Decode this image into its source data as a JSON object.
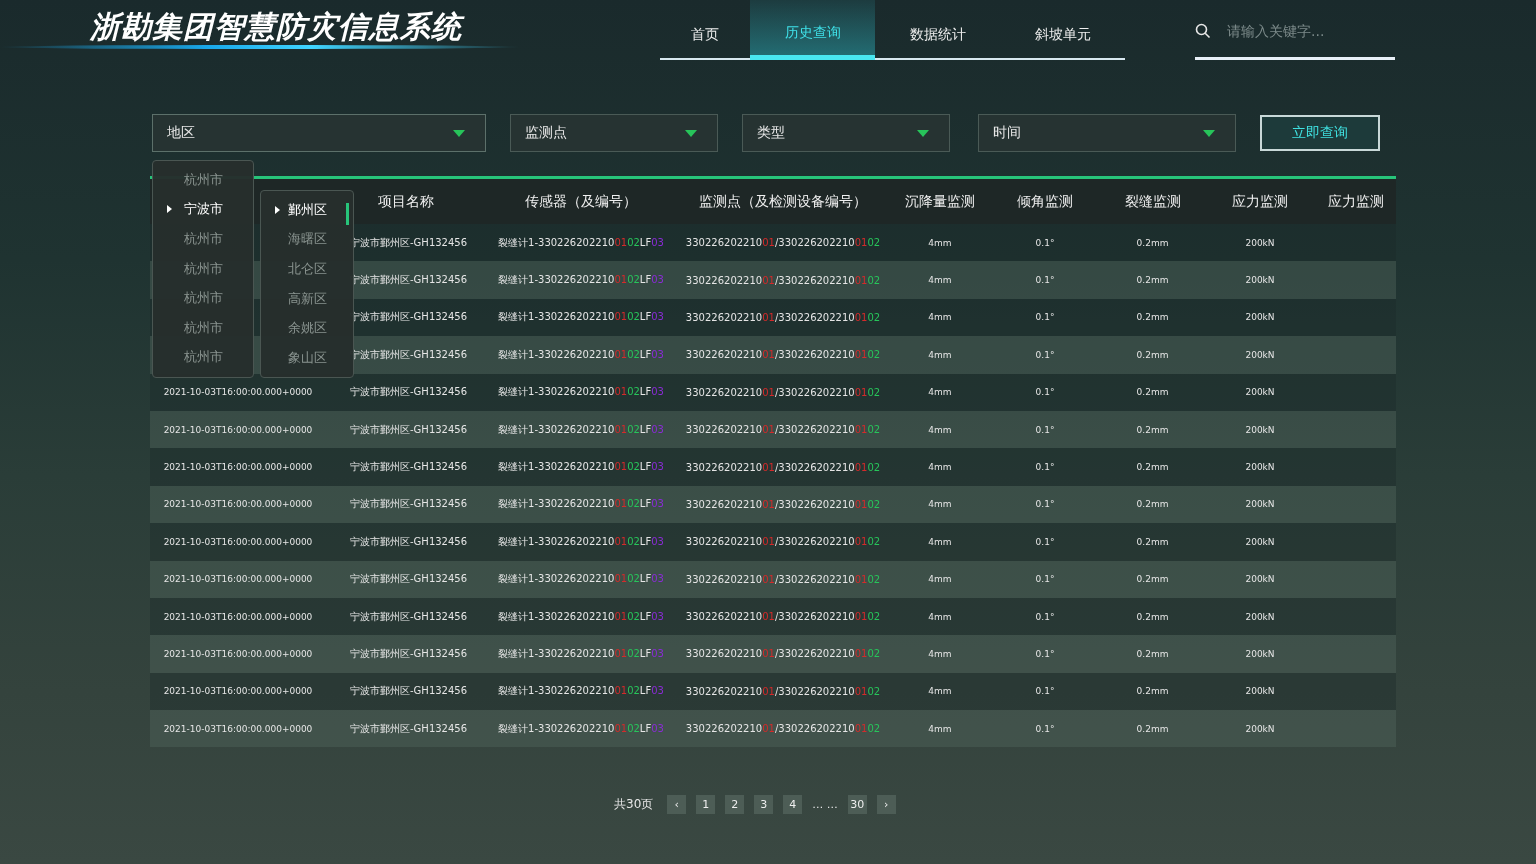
{
  "header": {
    "title": "浙勘集团智慧防灾信息系统",
    "tabs": [
      {
        "label": "首页",
        "selected": false
      },
      {
        "label": "历史查询",
        "selected": true
      },
      {
        "label": "数据统计",
        "selected": false
      },
      {
        "label": "斜坡单元",
        "selected": false
      }
    ],
    "search": {
      "placeholder": "请输入关键字..."
    }
  },
  "filters": [
    {
      "label": "地区",
      "open": true
    },
    {
      "label": "监测点",
      "open": false
    },
    {
      "label": "类型",
      "open": false
    },
    {
      "label": "时间",
      "open": false
    }
  ],
  "query_button": "立即查询",
  "cascader": [
    {
      "label": "杭州市",
      "selected": false
    },
    {
      "label": "宁波市",
      "selected": true,
      "children": [
        {
          "label": "鄞州区",
          "selected": true
        },
        {
          "label": "海曙区",
          "selected": false
        },
        {
          "label": "北仑区",
          "selected": false
        },
        {
          "label": "高新区",
          "selected": false
        },
        {
          "label": "余姚区",
          "selected": false
        },
        {
          "label": "象山区",
          "selected": false
        }
      ]
    },
    {
      "label": "杭州市",
      "selected": false
    },
    {
      "label": "杭州市",
      "selected": false
    },
    {
      "label": "杭州市",
      "selected": false
    },
    {
      "label": "杭州市",
      "selected": false
    },
    {
      "label": "杭州市",
      "selected": false
    }
  ],
  "table": {
    "columns": [
      "",
      "项目名称",
      "传感器（及编号）",
      "监测点（及检测设备编号）",
      "沉降量监测",
      "倾角监测",
      "裂缝监测",
      "应力监测",
      "应力监测"
    ],
    "rows": [
      {
        "time": "",
        "project": "宁波市鄞州区-GH132456",
        "sensor": [
          {
            "text": "裂缝计1-330226202210",
            "color": "#e6e6e6"
          },
          {
            "text": "01",
            "color": "#d42a2a"
          },
          {
            "text": "02",
            "color": "#27c45a"
          },
          {
            "text": "LF",
            "color": "#e6e6e6"
          },
          {
            "text": "03",
            "color": "#8a2bd6"
          }
        ],
        "point": [
          {
            "text": "330226202210",
            "color": "#e6e6e6"
          },
          {
            "text": "01",
            "color": "#d42a2a"
          },
          {
            "text": "/330226202210",
            "color": "#e6e6e6"
          },
          {
            "text": "01",
            "color": "#d42a2a"
          },
          {
            "text": "02",
            "color": "#27c45a"
          }
        ],
        "settlement": "4mm",
        "tilt": "0.1°",
        "crack": "0.2mm",
        "stress": "200kN"
      },
      {
        "time": "",
        "project": "宁波市鄞州区-GH132456",
        "sensor": [
          {
            "text": "裂缝计1-330226202210",
            "color": "#e6e6e6"
          },
          {
            "text": "01",
            "color": "#d42a2a"
          },
          {
            "text": "02",
            "color": "#27c45a"
          },
          {
            "text": "LF",
            "color": "#e6e6e6"
          },
          {
            "text": "03",
            "color": "#8a2bd6"
          }
        ],
        "point": [
          {
            "text": "330226202210",
            "color": "#e6e6e6"
          },
          {
            "text": "01",
            "color": "#d42a2a"
          },
          {
            "text": "/330226202210",
            "color": "#e6e6e6"
          },
          {
            "text": "01",
            "color": "#d42a2a"
          },
          {
            "text": "02",
            "color": "#27c45a"
          }
        ],
        "settlement": "4mm",
        "tilt": "0.1°",
        "crack": "0.2mm",
        "stress": "200kN"
      },
      {
        "time": "",
        "project": "宁波市鄞州区-GH132456",
        "sensor": [
          {
            "text": "裂缝计1-330226202210",
            "color": "#e6e6e6"
          },
          {
            "text": "01",
            "color": "#d42a2a"
          },
          {
            "text": "02",
            "color": "#27c45a"
          },
          {
            "text": "LF",
            "color": "#e6e6e6"
          },
          {
            "text": "03",
            "color": "#8a2bd6"
          }
        ],
        "point": [
          {
            "text": "330226202210",
            "color": "#e6e6e6"
          },
          {
            "text": "01",
            "color": "#d42a2a"
          },
          {
            "text": "/330226202210",
            "color": "#e6e6e6"
          },
          {
            "text": "01",
            "color": "#d42a2a"
          },
          {
            "text": "02",
            "color": "#27c45a"
          }
        ],
        "settlement": "4mm",
        "tilt": "0.1°",
        "crack": "0.2mm",
        "stress": "200kN"
      },
      {
        "time": "",
        "project": "宁波市鄞州区-GH132456",
        "sensor": [
          {
            "text": "裂缝计1-330226202210",
            "color": "#e6e6e6"
          },
          {
            "text": "01",
            "color": "#d42a2a"
          },
          {
            "text": "02",
            "color": "#27c45a"
          },
          {
            "text": "LF",
            "color": "#e6e6e6"
          },
          {
            "text": "03",
            "color": "#8a2bd6"
          }
        ],
        "point": [
          {
            "text": "330226202210",
            "color": "#e6e6e6"
          },
          {
            "text": "01",
            "color": "#d42a2a"
          },
          {
            "text": "/330226202210",
            "color": "#e6e6e6"
          },
          {
            "text": "01",
            "color": "#d42a2a"
          },
          {
            "text": "02",
            "color": "#27c45a"
          }
        ],
        "settlement": "4mm",
        "tilt": "0.1°",
        "crack": "0.2mm",
        "stress": "200kN"
      },
      {
        "time": "2021-10-03T16:00:00.000+0000",
        "project": "宁波市鄞州区-GH132456",
        "sensor": [
          {
            "text": "裂缝计1-330226202210",
            "color": "#e6e6e6"
          },
          {
            "text": "01",
            "color": "#d42a2a"
          },
          {
            "text": "02",
            "color": "#27c45a"
          },
          {
            "text": "LF",
            "color": "#e6e6e6"
          },
          {
            "text": "03",
            "color": "#8a2bd6"
          }
        ],
        "point": [
          {
            "text": "330226202210",
            "color": "#e6e6e6"
          },
          {
            "text": "01",
            "color": "#d42a2a"
          },
          {
            "text": "/330226202210",
            "color": "#e6e6e6"
          },
          {
            "text": "01",
            "color": "#d42a2a"
          },
          {
            "text": "02",
            "color": "#27c45a"
          }
        ],
        "settlement": "4mm",
        "tilt": "0.1°",
        "crack": "0.2mm",
        "stress": "200kN"
      },
      {
        "time": "2021-10-03T16:00:00.000+0000",
        "project": "宁波市鄞州区-GH132456",
        "sensor": [
          {
            "text": "裂缝计1-330226202210",
            "color": "#e6e6e6"
          },
          {
            "text": "01",
            "color": "#d42a2a"
          },
          {
            "text": "02",
            "color": "#27c45a"
          },
          {
            "text": "LF",
            "color": "#e6e6e6"
          },
          {
            "text": "03",
            "color": "#8a2bd6"
          }
        ],
        "point": [
          {
            "text": "330226202210",
            "color": "#e6e6e6"
          },
          {
            "text": "01",
            "color": "#d42a2a"
          },
          {
            "text": "/330226202210",
            "color": "#e6e6e6"
          },
          {
            "text": "01",
            "color": "#d42a2a"
          },
          {
            "text": "02",
            "color": "#27c45a"
          }
        ],
        "settlement": "4mm",
        "tilt": "0.1°",
        "crack": "0.2mm",
        "stress": "200kN"
      },
      {
        "time": "2021-10-03T16:00:00.000+0000",
        "project": "宁波市鄞州区-GH132456",
        "sensor": [
          {
            "text": "裂缝计1-330226202210",
            "color": "#e6e6e6"
          },
          {
            "text": "01",
            "color": "#d42a2a"
          },
          {
            "text": "02",
            "color": "#27c45a"
          },
          {
            "text": "LF",
            "color": "#e6e6e6"
          },
          {
            "text": "03",
            "color": "#8a2bd6"
          }
        ],
        "point": [
          {
            "text": "330226202210",
            "color": "#e6e6e6"
          },
          {
            "text": "01",
            "color": "#d42a2a"
          },
          {
            "text": "/330226202210",
            "color": "#e6e6e6"
          },
          {
            "text": "01",
            "color": "#d42a2a"
          },
          {
            "text": "02",
            "color": "#27c45a"
          }
        ],
        "settlement": "4mm",
        "tilt": "0.1°",
        "crack": "0.2mm",
        "stress": "200kN"
      },
      {
        "time": "2021-10-03T16:00:00.000+0000",
        "project": "宁波市鄞州区-GH132456",
        "sensor": [
          {
            "text": "裂缝计1-330226202210",
            "color": "#e6e6e6"
          },
          {
            "text": "01",
            "color": "#d42a2a"
          },
          {
            "text": "02",
            "color": "#27c45a"
          },
          {
            "text": "LF",
            "color": "#e6e6e6"
          },
          {
            "text": "03",
            "color": "#8a2bd6"
          }
        ],
        "point": [
          {
            "text": "330226202210",
            "color": "#e6e6e6"
          },
          {
            "text": "01",
            "color": "#d42a2a"
          },
          {
            "text": "/330226202210",
            "color": "#e6e6e6"
          },
          {
            "text": "01",
            "color": "#d42a2a"
          },
          {
            "text": "02",
            "color": "#27c45a"
          }
        ],
        "settlement": "4mm",
        "tilt": "0.1°",
        "crack": "0.2mm",
        "stress": "200kN"
      },
      {
        "time": "2021-10-03T16:00:00.000+0000",
        "project": "宁波市鄞州区-GH132456",
        "sensor": [
          {
            "text": "裂缝计1-330226202210",
            "color": "#e6e6e6"
          },
          {
            "text": "01",
            "color": "#d42a2a"
          },
          {
            "text": "02",
            "color": "#27c45a"
          },
          {
            "text": "LF",
            "color": "#e6e6e6"
          },
          {
            "text": "03",
            "color": "#8a2bd6"
          }
        ],
        "point": [
          {
            "text": "330226202210",
            "color": "#e6e6e6"
          },
          {
            "text": "01",
            "color": "#d42a2a"
          },
          {
            "text": "/330226202210",
            "color": "#e6e6e6"
          },
          {
            "text": "01",
            "color": "#d42a2a"
          },
          {
            "text": "02",
            "color": "#27c45a"
          }
        ],
        "settlement": "4mm",
        "tilt": "0.1°",
        "crack": "0.2mm",
        "stress": "200kN"
      },
      {
        "time": "2021-10-03T16:00:00.000+0000",
        "project": "宁波市鄞州区-GH132456",
        "sensor": [
          {
            "text": "裂缝计1-330226202210",
            "color": "#e6e6e6"
          },
          {
            "text": "01",
            "color": "#d42a2a"
          },
          {
            "text": "02",
            "color": "#27c45a"
          },
          {
            "text": "LF",
            "color": "#e6e6e6"
          },
          {
            "text": "03",
            "color": "#8a2bd6"
          }
        ],
        "point": [
          {
            "text": "330226202210",
            "color": "#e6e6e6"
          },
          {
            "text": "01",
            "color": "#d42a2a"
          },
          {
            "text": "/330226202210",
            "color": "#e6e6e6"
          },
          {
            "text": "01",
            "color": "#d42a2a"
          },
          {
            "text": "02",
            "color": "#27c45a"
          }
        ],
        "settlement": "4mm",
        "tilt": "0.1°",
        "crack": "0.2mm",
        "stress": "200kN"
      },
      {
        "time": "2021-10-03T16:00:00.000+0000",
        "project": "宁波市鄞州区-GH132456",
        "sensor": [
          {
            "text": "裂缝计1-330226202210",
            "color": "#e6e6e6"
          },
          {
            "text": "01",
            "color": "#d42a2a"
          },
          {
            "text": "02",
            "color": "#27c45a"
          },
          {
            "text": "LF",
            "color": "#e6e6e6"
          },
          {
            "text": "03",
            "color": "#8a2bd6"
          }
        ],
        "point": [
          {
            "text": "330226202210",
            "color": "#e6e6e6"
          },
          {
            "text": "01",
            "color": "#d42a2a"
          },
          {
            "text": "/330226202210",
            "color": "#e6e6e6"
          },
          {
            "text": "01",
            "color": "#d42a2a"
          },
          {
            "text": "02",
            "color": "#27c45a"
          }
        ],
        "settlement": "4mm",
        "tilt": "0.1°",
        "crack": "0.2mm",
        "stress": "200kN"
      },
      {
        "time": "2021-10-03T16:00:00.000+0000",
        "project": "宁波市鄞州区-GH132456",
        "sensor": [
          {
            "text": "裂缝计1-330226202210",
            "color": "#e6e6e6"
          },
          {
            "text": "01",
            "color": "#d42a2a"
          },
          {
            "text": "02",
            "color": "#27c45a"
          },
          {
            "text": "LF",
            "color": "#e6e6e6"
          },
          {
            "text": "03",
            "color": "#8a2bd6"
          }
        ],
        "point": [
          {
            "text": "330226202210",
            "color": "#e6e6e6"
          },
          {
            "text": "01",
            "color": "#d42a2a"
          },
          {
            "text": "/330226202210",
            "color": "#e6e6e6"
          },
          {
            "text": "01",
            "color": "#d42a2a"
          },
          {
            "text": "02",
            "color": "#27c45a"
          }
        ],
        "settlement": "4mm",
        "tilt": "0.1°",
        "crack": "0.2mm",
        "stress": "200kN"
      },
      {
        "time": "2021-10-03T16:00:00.000+0000",
        "project": "宁波市鄞州区-GH132456",
        "sensor": [
          {
            "text": "裂缝计1-330226202210",
            "color": "#e6e6e6"
          },
          {
            "text": "01",
            "color": "#d42a2a"
          },
          {
            "text": "02",
            "color": "#27c45a"
          },
          {
            "text": "LF",
            "color": "#e6e6e6"
          },
          {
            "text": "03",
            "color": "#8a2bd6"
          }
        ],
        "point": [
          {
            "text": "330226202210",
            "color": "#e6e6e6"
          },
          {
            "text": "01",
            "color": "#d42a2a"
          },
          {
            "text": "/330226202210",
            "color": "#e6e6e6"
          },
          {
            "text": "01",
            "color": "#d42a2a"
          },
          {
            "text": "02",
            "color": "#27c45a"
          }
        ],
        "settlement": "4mm",
        "tilt": "0.1°",
        "crack": "0.2mm",
        "stress": "200kN"
      },
      {
        "time": "2021-10-03T16:00:00.000+0000",
        "project": "宁波市鄞州区-GH132456",
        "sensor": [
          {
            "text": "裂缝计1-330226202210",
            "color": "#e6e6e6"
          },
          {
            "text": "01",
            "color": "#d42a2a"
          },
          {
            "text": "02",
            "color": "#27c45a"
          },
          {
            "text": "LF",
            "color": "#e6e6e6"
          },
          {
            "text": "03",
            "color": "#8a2bd6"
          }
        ],
        "point": [
          {
            "text": "330226202210",
            "color": "#e6e6e6"
          },
          {
            "text": "01",
            "color": "#d42a2a"
          },
          {
            "text": "/330226202210",
            "color": "#e6e6e6"
          },
          {
            "text": "01",
            "color": "#d42a2a"
          },
          {
            "text": "02",
            "color": "#27c45a"
          }
        ],
        "settlement": "4mm",
        "tilt": "0.1°",
        "crack": "0.2mm",
        "stress": "200kN"
      }
    ]
  },
  "pagination": {
    "total": "共30页",
    "prev": "‹",
    "pages": [
      {
        "label": "1",
        "selected": false
      },
      {
        "label": "2",
        "selected": false
      },
      {
        "label": "3",
        "selected": false
      },
      {
        "label": "4",
        "selected": false
      }
    ],
    "ellipsis": "… …",
    "last": {
      "label": "30",
      "selected": false
    },
    "next": "›"
  }
}
